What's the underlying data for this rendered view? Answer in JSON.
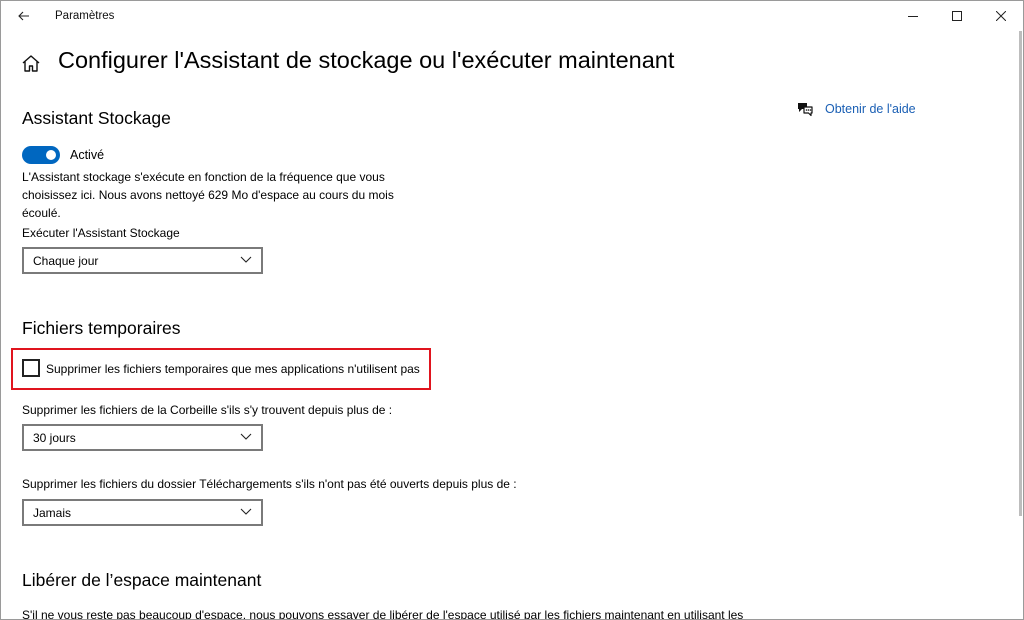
{
  "window": {
    "title": "Paramètres"
  },
  "header": {
    "title": "Configurer l'Assistant de stockage ou l'exécuter maintenant"
  },
  "help": {
    "link_label": "Obtenir de l'aide"
  },
  "assistant": {
    "section_title": "Assistant Stockage",
    "toggle_state": "Activé",
    "toggle_on": true,
    "description": "L'Assistant stockage s'exécute en fonction de la fréquence que vous choisissez ici. Nous avons nettoyé 629 Mo d'espace au cours du mois écoulé.",
    "run_label": "Exécuter l'Assistant Stockage",
    "run_value": "Chaque jour"
  },
  "temp_files": {
    "section_title": "Fichiers temporaires",
    "checkbox_label": "Supprimer les fichiers temporaires que mes applications n'utilisent pas",
    "checkbox_checked": false,
    "recycle_label": "Supprimer les fichiers de la Corbeille s'ils s'y trouvent depuis plus de :",
    "recycle_value": "30 jours",
    "downloads_label": "Supprimer les fichiers du dossier Téléchargements s'ils n'ont pas été ouverts depuis plus de :",
    "downloads_value": "Jamais"
  },
  "free_space": {
    "section_title": "Libérer de l’espace maintenant",
    "description": "S'il ne vous reste pas beaucoup d'espace, nous pouvons essayer de libérer de l'espace utilisé par les fichiers maintenant en utilisant les"
  },
  "colors": {
    "accent": "#0067c0",
    "link": "#1a5fb4",
    "highlight": "#e0141e"
  }
}
